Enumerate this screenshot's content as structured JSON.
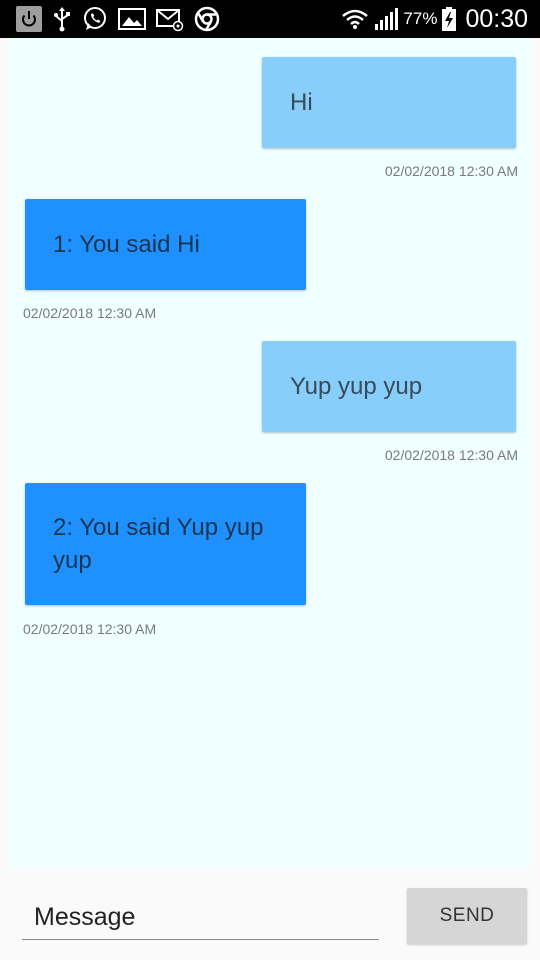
{
  "status_bar": {
    "left_icons": [
      "power-icon",
      "usb-icon",
      "whatsapp-icon",
      "image-icon",
      "email-icon",
      "chrome-icon"
    ],
    "right_icons": [
      "wifi-icon",
      "signal-icon",
      "battery-icon"
    ],
    "battery_percent": "77%",
    "time": "00:30"
  },
  "messages": [
    {
      "direction": "sent",
      "text": "Hi",
      "timestamp": "02/02/2018 12:30 AM"
    },
    {
      "direction": "received",
      "text": "1: You said Hi",
      "timestamp": "02/02/2018 12:30 AM"
    },
    {
      "direction": "sent",
      "text": "Yup yup yup",
      "timestamp": "02/02/2018 12:30 AM"
    },
    {
      "direction": "received",
      "text": "2: You said Yup yup yup",
      "timestamp": "02/02/2018 12:30 AM"
    }
  ],
  "composer": {
    "placeholder": "Message",
    "send_label": "SEND"
  },
  "colors": {
    "status_bar": "#000000",
    "chat_background": "#f0ffff",
    "sent_bubble": "#87cefa",
    "received_bubble": "#1e90ff",
    "send_button": "#d6d6d6"
  }
}
